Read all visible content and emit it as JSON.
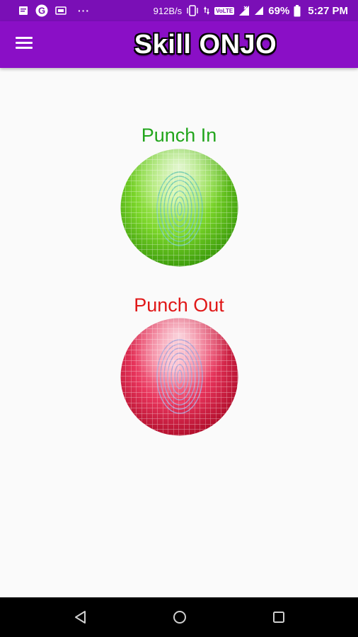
{
  "status_bar": {
    "network_speed": "912B/s",
    "volte": "VoLTE",
    "battery": "69%",
    "time": "5:27 PM",
    "overflow": "···"
  },
  "app_bar": {
    "title": "Skill ONJO"
  },
  "punch_in": {
    "label": "Punch In",
    "color": "#22a51c"
  },
  "punch_out": {
    "label": "Punch Out",
    "color": "#e01818"
  },
  "icons": {
    "menu": "hamburger-menu-icon",
    "back": "back-triangle-icon",
    "home": "home-circle-icon",
    "recents": "recents-square-icon"
  }
}
